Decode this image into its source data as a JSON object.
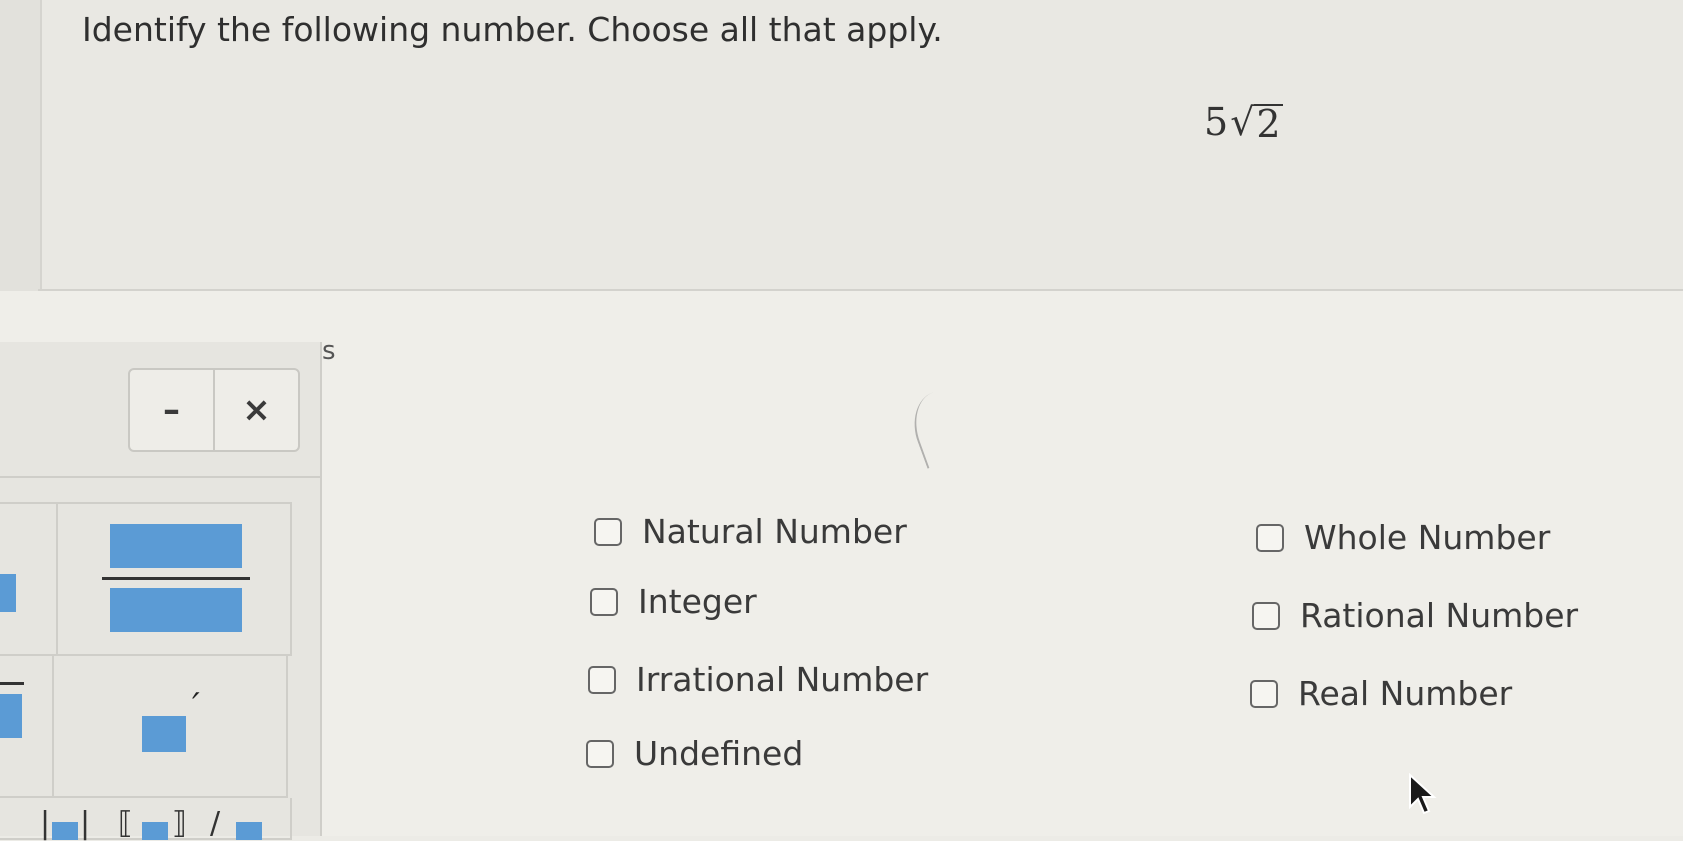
{
  "question": {
    "prompt": "Identify the following number. Choose all that apply.",
    "expression": {
      "coefficient": "5",
      "radical": "√",
      "radicand": "2"
    }
  },
  "palette": {
    "partial_heading_fragment": "s",
    "controls": {
      "minimize_label": "–",
      "close_label": "×"
    },
    "tools": [
      "fraction-template",
      "prime-template",
      "absolute-value-template",
      "bracket-template",
      "root-template"
    ]
  },
  "options": [
    {
      "id": "natural",
      "label": "Natural Number",
      "checked": false
    },
    {
      "id": "integer",
      "label": "Integer",
      "checked": false
    },
    {
      "id": "irrational",
      "label": "Irrational Number",
      "checked": false
    },
    {
      "id": "undefined",
      "label": "Undefined",
      "checked": false
    },
    {
      "id": "whole",
      "label": "Whole Number",
      "checked": false
    },
    {
      "id": "rational",
      "label": "Rational Number",
      "checked": false
    },
    {
      "id": "real",
      "label": "Real Number",
      "checked": false
    }
  ],
  "colors": {
    "background": "#ecebe6",
    "template_blue": "#5b9bd5",
    "text": "#2f2f2f"
  },
  "icons": [
    "minimize-icon",
    "close-icon",
    "mouse-cursor-icon"
  ]
}
